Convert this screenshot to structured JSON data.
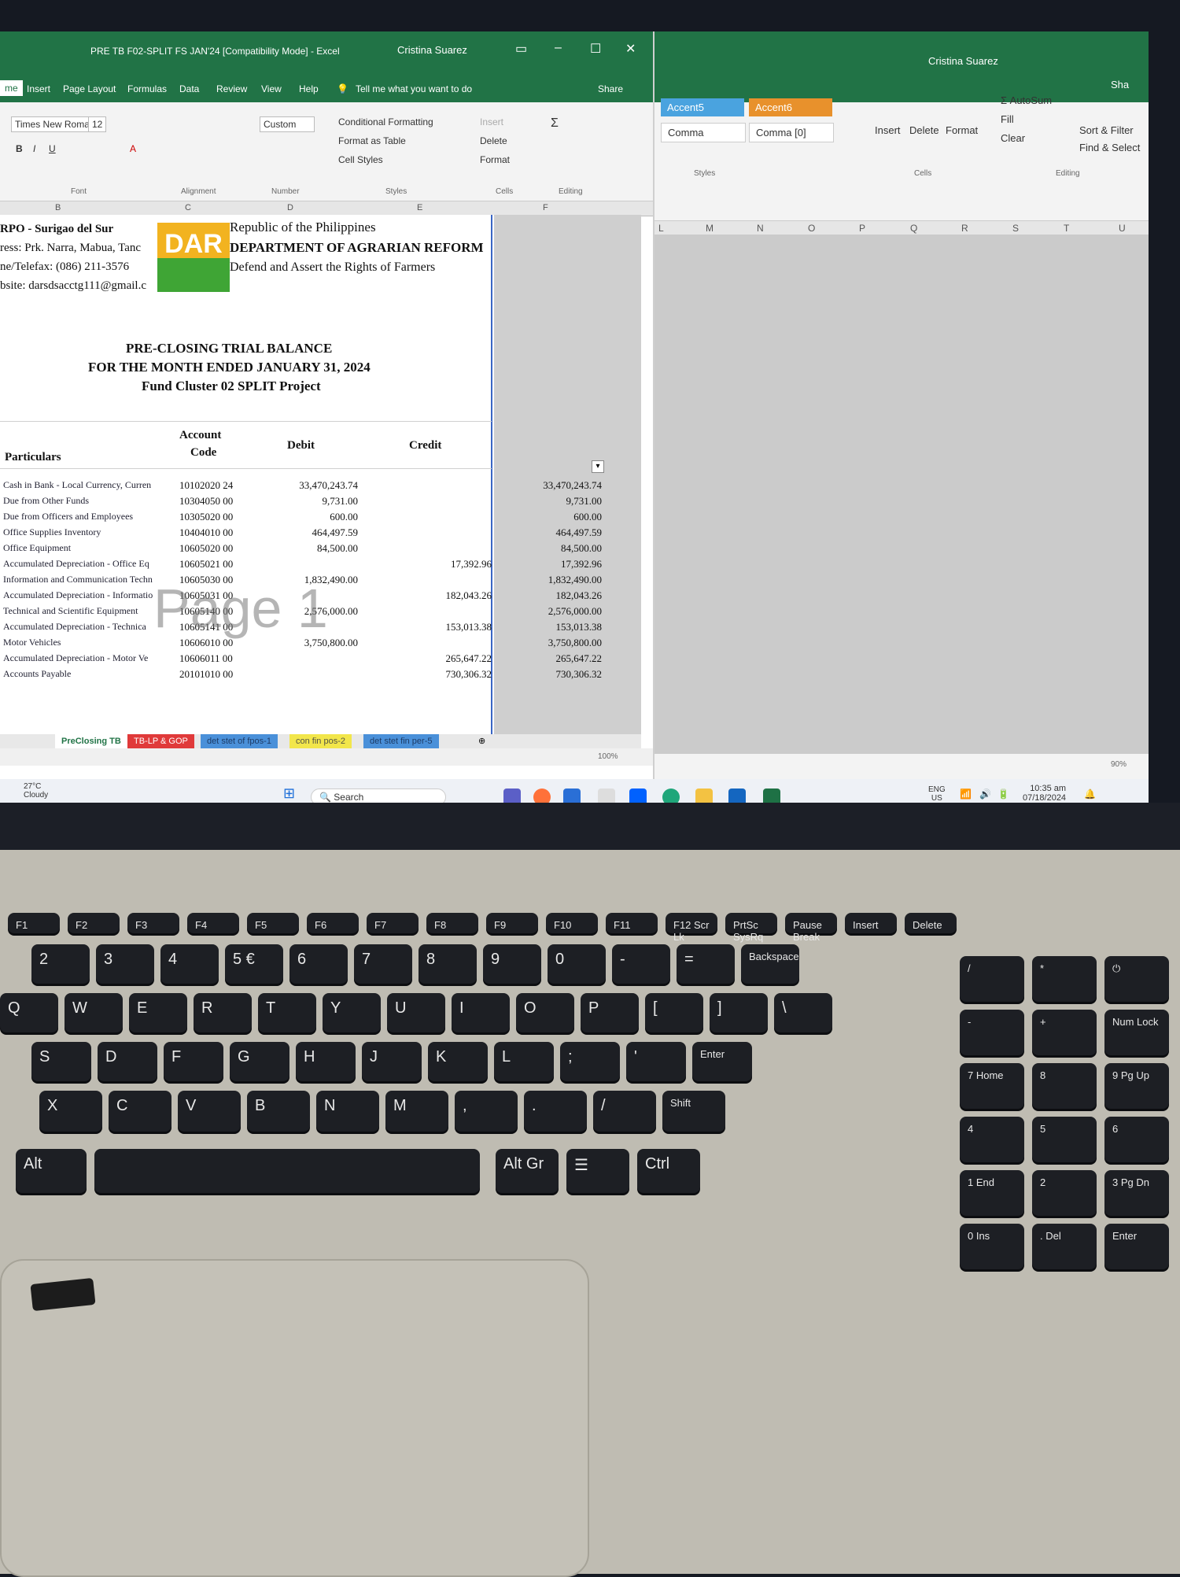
{
  "excel_left": {
    "title": "PRE TB F02-SPLIT FS JAN'24 [Compatibility Mode] - Excel",
    "user": "Cristina Suarez",
    "share": "Share",
    "tell_me": "Tell me what you want to do",
    "ribbon_tabs": [
      "me",
      "Insert",
      "Page Layout",
      "Formulas",
      "Data",
      "Review",
      "View",
      "Help"
    ],
    "font_name": "Times New Roma",
    "font_size": "12",
    "number_format": "Custom",
    "styles": [
      "Conditional Formatting",
      "Format as Table",
      "Cell Styles"
    ],
    "cells_group": [
      "Insert",
      "Delete",
      "Format"
    ],
    "groups": [
      "Font",
      "Alignment",
      "Number",
      "Styles",
      "Cells",
      "Editing"
    ],
    "columns": [
      "B",
      "C",
      "D",
      "E",
      "F"
    ],
    "header_lines": [
      "RPO - Surigao del Sur",
      "ress: Prk. Narra, Mabua, Tanc",
      "ne/Telefax: (086) 211-3576",
      "bsite: darsdsacctg111@gmail.c"
    ],
    "agency": [
      "Republic of the Philippines",
      "DEPARTMENT OF AGRARIAN REFORM",
      "Defend and Assert the Rights of Farmers"
    ],
    "logo_text": "DAR",
    "report_title": [
      "PRE-CLOSING TRIAL BALANCE",
      "FOR THE MONTH ENDED JANUARY 31, 2024",
      "Fund Cluster 02 SPLIT Project"
    ],
    "col_headers": {
      "particulars": "Particulars",
      "account": "Account",
      "code": "Code",
      "debit": "Debit",
      "credit": "Credit"
    },
    "rows": [
      {
        "p": "Cash in Bank - Local Currency, Curren",
        "c": "10102020 24",
        "d": "33,470,243.74",
        "cr": "",
        "f": "33,470,243.74"
      },
      {
        "p": "Due from Other Funds",
        "c": "10304050 00",
        "d": "9,731.00",
        "cr": "",
        "f": "9,731.00"
      },
      {
        "p": "Due from Officers and Employees",
        "c": "10305020 00",
        "d": "600.00",
        "cr": "",
        "f": "600.00"
      },
      {
        "p": "Office Supplies Inventory",
        "c": "10404010 00",
        "d": "464,497.59",
        "cr": "",
        "f": "464,497.59"
      },
      {
        "p": "Office Equipment",
        "c": "10605020 00",
        "d": "84,500.00",
        "cr": "",
        "f": "84,500.00"
      },
      {
        "p": "Accumulated Depreciation - Office Eq",
        "c": "10605021 00",
        "d": "",
        "cr": "17,392.96",
        "f": "17,392.96"
      },
      {
        "p": "Information and Communication Techn",
        "c": "10605030 00",
        "d": "1,832,490.00",
        "cr": "",
        "f": "1,832,490.00"
      },
      {
        "p": "Accumulated Depreciation - Informatio",
        "c": "10605031 00",
        "d": "",
        "cr": "182,043.26",
        "f": "182,043.26"
      },
      {
        "p": "Technical and Scientific Equipment",
        "c": "10605140 00",
        "d": "2,576,000.00",
        "cr": "",
        "f": "2,576,000.00"
      },
      {
        "p": "Accumulated Depreciation - Technica",
        "c": "10605141 00",
        "d": "",
        "cr": "153,013.38",
        "f": "153,013.38"
      },
      {
        "p": "Motor Vehicles",
        "c": "10606010 00",
        "d": "3,750,800.00",
        "cr": "",
        "f": "3,750,800.00"
      },
      {
        "p": "Accumulated Depreciation - Motor Ve",
        "c": "10606011 00",
        "d": "",
        "cr": "265,647.22",
        "f": "265,647.22"
      },
      {
        "p": "Accounts Payable",
        "c": "20101010 00",
        "d": "",
        "cr": "730,306.32",
        "f": "730,306.32"
      }
    ],
    "watermark": "Page 1",
    "sheet_tabs": [
      "PreClosing TB",
      "TB-LP & GOP",
      "det stet of fpos-1",
      "con fin pos-2",
      "det stet fin per-5"
    ],
    "zoom": "100%"
  },
  "excel_right": {
    "user": "Cristina Suarez",
    "share": "Sha",
    "style_cells": [
      "Accent5",
      "Accent6",
      "Comma",
      "Comma [0]"
    ],
    "cells_group": [
      "Insert",
      "Delete",
      "Format"
    ],
    "editing": [
      "AutoSum",
      "Fill",
      "Clear",
      "Sort & Filter",
      "Find & Select"
    ],
    "groups": [
      "Styles",
      "Cells",
      "Editing"
    ],
    "columns": [
      "L",
      "M",
      "N",
      "O",
      "P",
      "Q",
      "R",
      "S",
      "T",
      "U"
    ],
    "zoom": "90%"
  },
  "taskbar": {
    "weather_temp": "27°C",
    "weather_desc": "Cloudy",
    "search": "Search",
    "lang": "ENG",
    "region": "US",
    "time": "10:35 am",
    "date": "07/18/2024"
  },
  "keyboard": {
    "fn_row": [
      "F1",
      "F2",
      "F3",
      "F4",
      "F5",
      "F6",
      "F7",
      "F8",
      "F9",
      "F10",
      "F11",
      "F12 Scr Lk",
      "PrtSc SysRq",
      "Pause Break",
      "Insert",
      "Delete"
    ],
    "row1": [
      "2",
      "3",
      "4",
      "5 €",
      "6",
      "7",
      "8",
      "9",
      "0",
      "-",
      "=",
      "Backspace"
    ],
    "row2": [
      "Q",
      "W",
      "E",
      "R",
      "T",
      "Y",
      "U",
      "I",
      "O",
      "P",
      "[",
      "]",
      "\\"
    ],
    "row3": [
      "S",
      "D",
      "F",
      "G",
      "H",
      "J",
      "K",
      "L",
      ";",
      "'",
      "Enter"
    ],
    "row4": [
      "X",
      "C",
      "V",
      "B",
      "N",
      "M",
      ",",
      ".",
      "/",
      "Shift"
    ],
    "row5": [
      "Alt",
      "Alt Gr",
      "☰",
      "Ctrl"
    ],
    "numpad": [
      "/",
      "*",
      "⏻",
      "-",
      "+",
      "Num Lock",
      "7 Home",
      "8",
      "9 Pg Up",
      "4",
      "5",
      "6",
      "1 End",
      "2",
      "3 Pg Dn",
      "0 Ins",
      ". Del",
      "Enter"
    ]
  }
}
